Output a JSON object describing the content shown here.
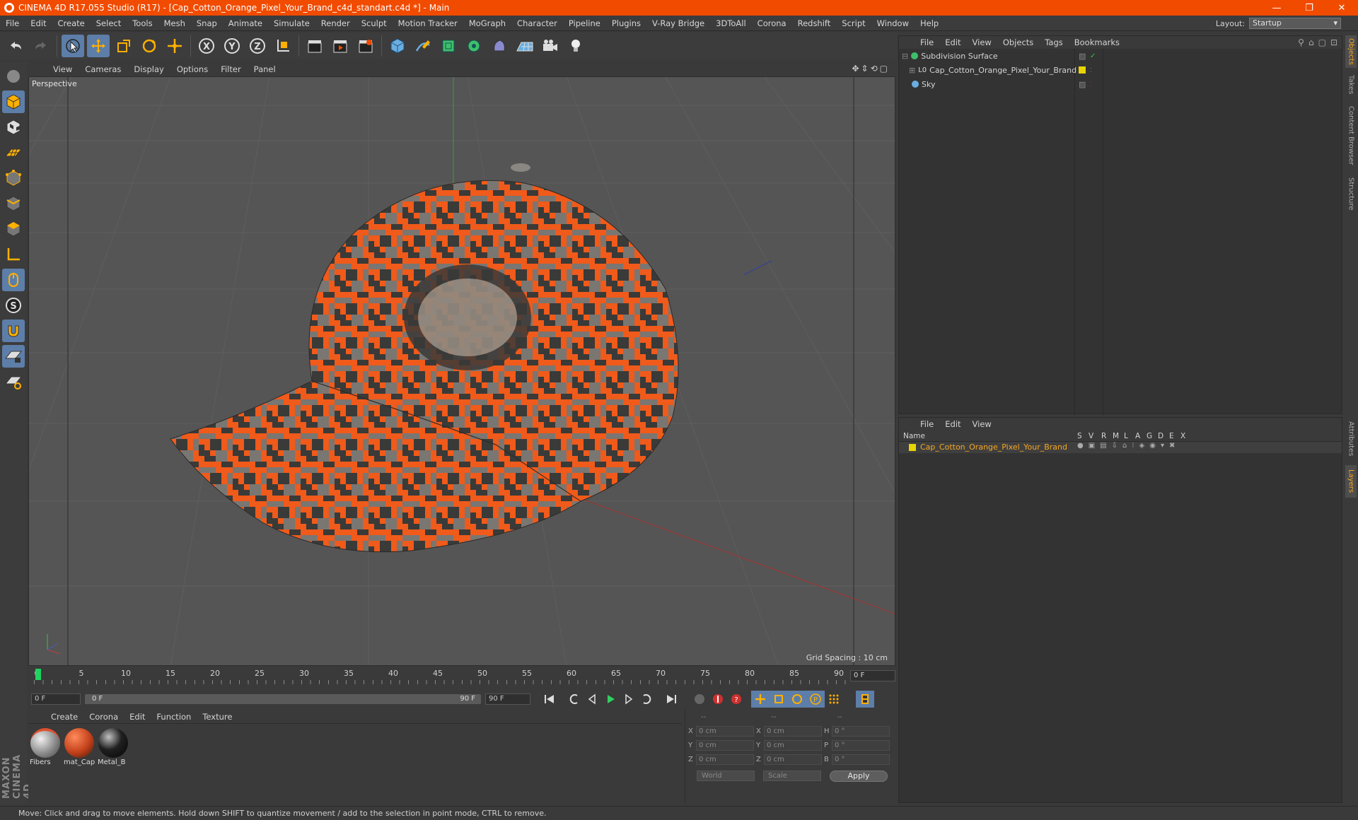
{
  "titlebar": {
    "title": "CINEMA 4D R17.055 Studio (R17) - [Cap_Cotton_Orange_Pixel_Your_Brand_c4d_standart.c4d *] - Main"
  },
  "menubar": {
    "items": [
      "File",
      "Edit",
      "Create",
      "Select",
      "Tools",
      "Mesh",
      "Snap",
      "Animate",
      "Simulate",
      "Render",
      "Sculpt",
      "Motion Tracker",
      "MoGraph",
      "Character",
      "Pipeline",
      "Plugins",
      "V-Ray Bridge",
      "3DToAll",
      "Corona",
      "Redshift",
      "Script",
      "Window",
      "Help"
    ]
  },
  "layout": {
    "label": "Layout:",
    "value": "Startup"
  },
  "viewport": {
    "menu": [
      "View",
      "Cameras",
      "Display",
      "Options",
      "Filter",
      "Panel"
    ],
    "label": "Perspective",
    "grid_spacing": "Grid Spacing : 10 cm"
  },
  "timeline": {
    "ticks": [
      "0",
      "5",
      "10",
      "15",
      "20",
      "25",
      "30",
      "35",
      "40",
      "45",
      "50",
      "55",
      "60",
      "65",
      "70",
      "75",
      "80",
      "85",
      "90"
    ],
    "current_frame": "0 F",
    "start_field": "0 F",
    "slider_start": "0 F",
    "slider_end": "90 F",
    "end_field": "90 F"
  },
  "materials": {
    "menu": [
      "Create",
      "Corona",
      "Edit",
      "Function",
      "Texture"
    ],
    "items": [
      {
        "name": "Fibers"
      },
      {
        "name": "mat_Cap"
      },
      {
        "name": "Metal_B"
      }
    ]
  },
  "coords": {
    "headers": [
      "--",
      "--",
      "--"
    ],
    "rows": [
      {
        "a1": "X",
        "v1": "0 cm",
        "a2": "X",
        "v2": "0 cm",
        "a3": "H",
        "v3": "0 °"
      },
      {
        "a1": "Y",
        "v1": "0 cm",
        "a2": "Y",
        "v2": "0 cm",
        "a3": "P",
        "v3": "0 °"
      },
      {
        "a1": "Z",
        "v1": "0 cm",
        "a2": "Z",
        "v2": "0 cm",
        "a3": "B",
        "v3": "0 °"
      }
    ],
    "space": "World",
    "mode": "Scale",
    "apply": "Apply"
  },
  "object_manager": {
    "menu": [
      "File",
      "Edit",
      "View",
      "Objects",
      "Tags",
      "Bookmarks"
    ],
    "objects": [
      {
        "name": "Subdivision Surface"
      },
      {
        "name": "Cap_Cotton_Orange_Pixel_Your_Brand"
      },
      {
        "name": "Sky"
      }
    ]
  },
  "layer_manager": {
    "menu": [
      "File",
      "Edit",
      "View"
    ],
    "columns": [
      "Name",
      "S",
      "V",
      "R",
      "M",
      "L",
      "A",
      "G",
      "D",
      "E",
      "X"
    ],
    "layers": [
      {
        "name": "Cap_Cotton_Orange_Pixel_Your_Brand"
      }
    ]
  },
  "right_tabs": [
    "Objects",
    "Takes",
    "Content Browser",
    "Structure",
    "Attributes",
    "Layers"
  ],
  "status": "Move: Click and drag to move elements. Hold down SHIFT to quantize movement / add to the selection in point mode, CTRL to remove.",
  "branding": "MAXON CINEMA 4D",
  "colors": {
    "title_bg": "#f14b00",
    "accent_blue": "#5d7ea8",
    "layer_name": "#f5a623",
    "layer_swatch": "#e8d400"
  }
}
